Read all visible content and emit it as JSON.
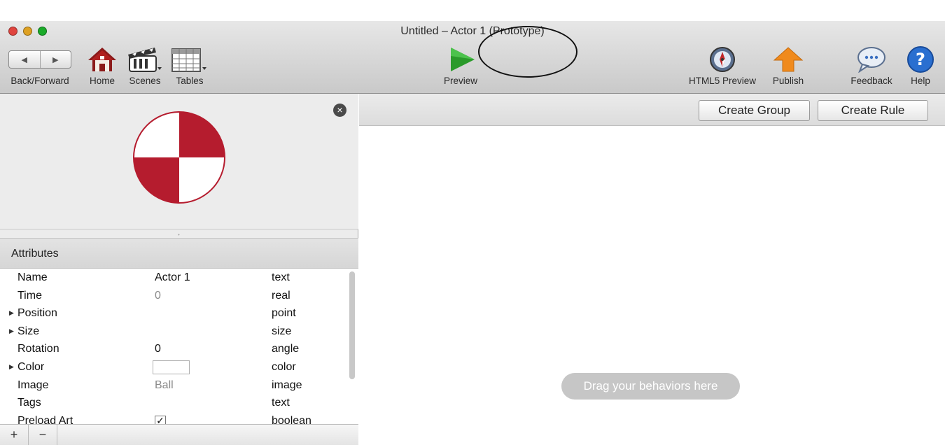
{
  "window": {
    "title": "Untitled – Actor 1 (Prototype)",
    "traffic_colors": [
      "#e0443e",
      "#dea123",
      "#1aab29"
    ]
  },
  "toolbar": {
    "back_forward_label": "Back/Forward",
    "home_label": "Home",
    "scenes_label": "Scenes",
    "tables_label": "Tables",
    "preview_label": "Preview",
    "html5_preview_label": "HTML5 Preview",
    "publish_label": "Publish",
    "feedback_label": "Feedback",
    "help_label": "Help",
    "preview_color": "#2a9a2a",
    "publish_color": "#f08a1c"
  },
  "actor_preview": {
    "image_name": "ball",
    "fill_color": "#b51c2e"
  },
  "attributes": {
    "header": "Attributes",
    "rows": [
      {
        "name": "Name",
        "value": "Actor 1",
        "type": "text"
      },
      {
        "name": "Time",
        "value": "0",
        "type": "real"
      },
      {
        "name": "Position",
        "value": "",
        "type": "point"
      },
      {
        "name": "Size",
        "value": "",
        "type": "size"
      },
      {
        "name": "Rotation",
        "value": "0",
        "type": "angle"
      },
      {
        "name": "Color",
        "value": "",
        "type": "color"
      },
      {
        "name": "Image",
        "value": "Ball",
        "type": "image"
      },
      {
        "name": "Tags",
        "value": "",
        "type": "text"
      },
      {
        "name": "Preload Art",
        "value": "",
        "type": "boolean",
        "checked": true
      }
    ]
  },
  "bottom_bar": {
    "add_label": "+",
    "remove_label": "−"
  },
  "behaviors": {
    "create_group_label": "Create Group",
    "create_rule_label": "Create Rule",
    "drop_hint": "Drag your behaviors here"
  }
}
